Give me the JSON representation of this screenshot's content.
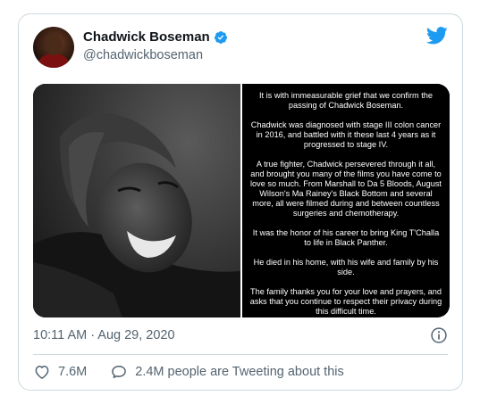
{
  "tweet": {
    "author": {
      "display_name": "Chadwick Boseman",
      "handle": "@chadwickboseman",
      "verified": true
    },
    "statement": [
      "It is with immeasurable grief that we confirm the passing of Chadwick Boseman.",
      "Chadwick was diagnosed with stage III colon cancer in 2016, and battled with it these last 4 years as it progressed to stage IV.",
      "A true fighter, Chadwick persevered through it all, and brought you many of the films you have come to love so much. From Marshall to Da 5 Bloods, August Wilson's Ma Rainey's Black Bottom and several more, all were filmed during and between countless surgeries and chemotherapy.",
      "It was the honor of his career to bring King T'Challa to life in Black Panther.",
      "He died in his home, with his wife and family by his side.",
      "The family thanks you for your love and prayers, and asks that you continue to respect their privacy during this difficult time."
    ],
    "timestamp": "10:11 AM · Aug 29, 2020",
    "likes": "7.6M",
    "conversation": "2.4M people are Tweeting about this"
  },
  "colors": {
    "twitter_blue": "#1d9bf0",
    "secondary_text": "#536471",
    "border": "#cfd9de"
  },
  "icons": {
    "brand": "twitter-bird-icon",
    "verified": "verified-badge-icon",
    "info": "info-icon",
    "like": "heart-icon",
    "conversation": "speech-bubble-icon"
  }
}
